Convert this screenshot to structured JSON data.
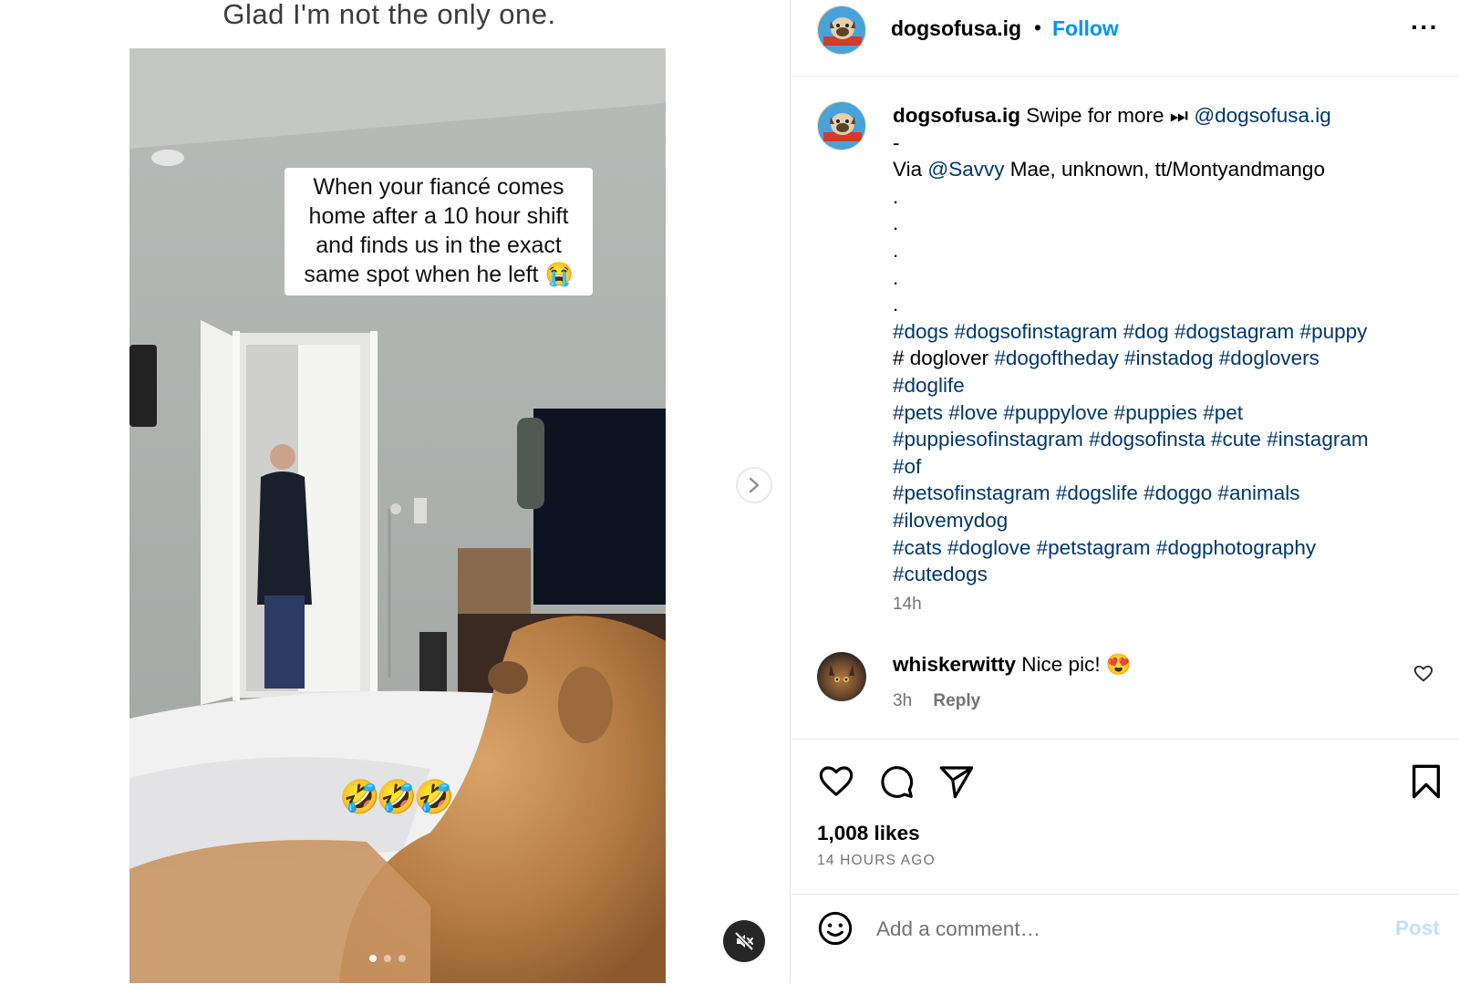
{
  "media": {
    "top_caption": "Glad I'm not the only one.",
    "overlay_lines": [
      "When your fiancé comes",
      "home after a 10 hour shift",
      "and finds us in the exact",
      "same spot when he left 😭"
    ],
    "emojis": "🤣🤣🤣",
    "carousel": {
      "count": 3,
      "active": 0
    }
  },
  "post": {
    "header": {
      "username": "dogsofusa.ig",
      "separator": "•",
      "follow_label": "Follow",
      "more_label": "···"
    },
    "caption": {
      "username": "dogsofusa.ig",
      "intro": " Swipe for more ⏭ ",
      "intro_mention": "@dogsofusa.ig",
      "dash": "-",
      "via_prefix": "Via ",
      "via_mention": "@Savvy",
      "via_rest": " Mae, unknown, tt/Montyandmango",
      "dots": [
        ".",
        ".",
        ".",
        ".",
        "."
      ],
      "hashtag_lines": [
        "#dogs #dogsofinstagram #dog #dogstagram #puppy",
        "# doglover #dogoftheday #instadog #doglovers",
        "#doglife",
        "#pets #love #puppylove #puppies #pet",
        "#puppiesofinstagram #dogsofinsta #cute #instagram",
        "#of",
        "#petsofinstagram #dogslife #doggo #animals",
        "#ilovemydog",
        "#cats #doglove #petstagram #dogphotography",
        "#cutedogs"
      ],
      "time": "14h"
    },
    "comment": {
      "username": "whiskerwitty",
      "text": " Nice pic! 😍",
      "time": "3h",
      "reply_label": "Reply"
    },
    "likes": "1,008 likes",
    "posted": "14 HOURS AGO",
    "add_comment_placeholder": "Add a comment…",
    "post_label": "Post"
  },
  "icons": [
    "chevron-right-icon",
    "mute-icon",
    "heart-icon",
    "comment-icon",
    "share-icon",
    "bookmark-icon",
    "emoji-icon",
    "more-icon"
  ],
  "colors": {
    "link": "#0095f6",
    "hashtag": "#00376b",
    "muted": "#737373",
    "post_disabled": "#c0dffd"
  }
}
